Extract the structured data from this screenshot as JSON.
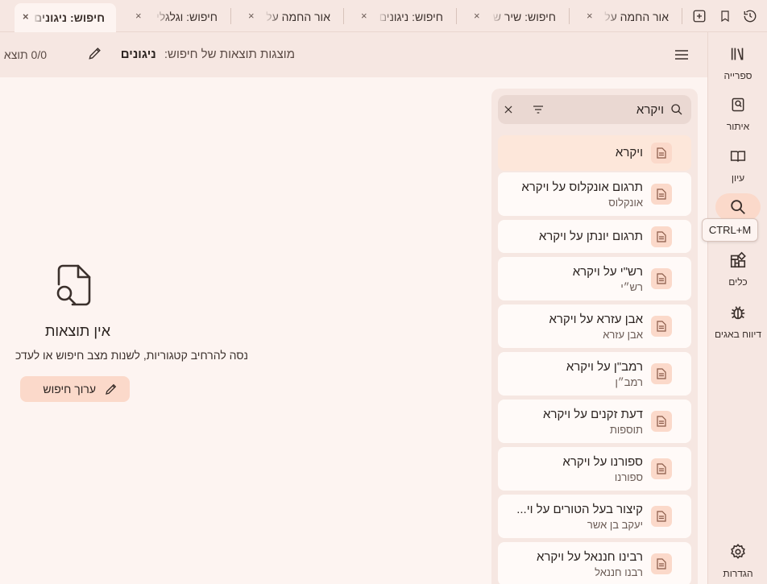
{
  "tabs": [
    {
      "label": "חיפוש: ניגונים",
      "active": true
    },
    {
      "label": "חיפוש: וגלגלי",
      "active": false
    },
    {
      "label": "אור החמה על",
      "active": false
    },
    {
      "label": "חיפוש: ניגונים",
      "active": false
    },
    {
      "label": "חיפוש: שיר ש",
      "active": false
    },
    {
      "label": "אור החמה על",
      "active": false
    }
  ],
  "tab_close_glyph": "×",
  "tabbar_icons": [
    "add-tab-icon",
    "bookmark-icon",
    "history-icon"
  ],
  "rail": {
    "items": [
      {
        "label": "ספרייה",
        "icon": "library-icon"
      },
      {
        "label": "איתור",
        "icon": "find-book-icon"
      },
      {
        "label": "עיון",
        "icon": "reading-icon"
      },
      {
        "label": "",
        "icon": "search-icon",
        "active": true
      },
      {
        "label": "כלים",
        "icon": "tools-icon"
      },
      {
        "label": "דיווח באגים",
        "icon": "bug-icon"
      }
    ],
    "settings_label": "הגדרות",
    "tooltip": "CTRL+M"
  },
  "header": {
    "prefix": "מוצגות תוצאות של חיפוש:",
    "query": "ניגונים",
    "count": "0/0 תוצא"
  },
  "search": {
    "value": "ויקרא",
    "placeholder": ""
  },
  "results": [
    {
      "title": "ויקרא",
      "subtitle": "",
      "selected": true
    },
    {
      "title": "תרגום אונקלוס על ויקרא",
      "subtitle": "אונקלוס"
    },
    {
      "title": "תרגום יונתן על ויקרא",
      "subtitle": ""
    },
    {
      "title": "רש\"י על ויקרא",
      "subtitle": "רש״י"
    },
    {
      "title": "אבן עזרא על ויקרא",
      "subtitle": "אבן עזרא"
    },
    {
      "title": "רמב\"ן על ויקרא",
      "subtitle": "רמב״ן"
    },
    {
      "title": "דעת זקנים על ויקרא",
      "subtitle": "תוספות"
    },
    {
      "title": "ספורנו על ויקרא",
      "subtitle": "ספורנו"
    },
    {
      "title": "קיצור בעל הטורים על וי...",
      "subtitle": "יעקב בן אשר"
    },
    {
      "title": "רבינו חננאל על ויקרא",
      "subtitle": "רבנו חננאל"
    }
  ],
  "empty_state": {
    "title": "אין תוצאות",
    "subtitle": "נסה להרחיב קטגוריות, לשנות מצב חיפוש או לעדכ",
    "button_label": "ערוך חיפוש"
  },
  "colors": {
    "background": "#fdf4f1",
    "panel": "#f6e7e2",
    "accent": "#fbd9ca",
    "selected_card": "#fde7da"
  }
}
